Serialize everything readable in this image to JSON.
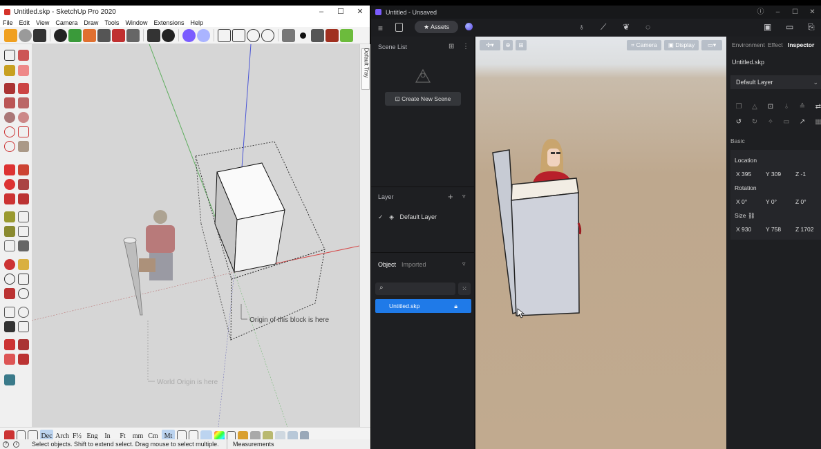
{
  "sketchup": {
    "title": "Untitled.skp - SketchUp Pro 2020",
    "menu": [
      "File",
      "Edit",
      "View",
      "Camera",
      "Draw",
      "Tools",
      "Window",
      "Extensions",
      "Help"
    ],
    "tray_label": "Default Tray",
    "units": [
      "Dec",
      "Arch",
      "F½",
      "Eng",
      "In",
      "Ft",
      "mm",
      "Cm",
      "Mt"
    ],
    "active_unit": "Mt",
    "annotation_block": "Origin of this block is here",
    "annotation_world": "World Origin is here",
    "status_message": "Select objects. Shift to extend select. Drag mouse to select multiple.",
    "measurements_label": "Measurements",
    "colors": {
      "accent": "#d5332a",
      "viewport": "#d6d6d6"
    }
  },
  "d5": {
    "title": "Untitled - Unsaved",
    "assets_button": "Assets",
    "scene_list_title": "Scene List",
    "create_scene_button": "Create New Scene",
    "layer_title": "Layer",
    "layer_item": "Default Layer",
    "object_tab": "Object",
    "imported_tab": "Imported",
    "object_item": "Untitled.skp",
    "viewport_buttons": {
      "camera": "Camera",
      "display": "Display"
    },
    "inspector": {
      "tabs": [
        "Environment",
        "Effect",
        "Inspector"
      ],
      "active_tab": "Inspector",
      "file_name": "Untitled.skp",
      "layer_select": "Default Layer",
      "basic_label": "Basic",
      "location_label": "Location",
      "location": {
        "x": "X 395",
        "y": "Y 309",
        "z": "Z -1"
      },
      "rotation_label": "Rotation",
      "rotation": {
        "x": "X 0°",
        "y": "Y 0°",
        "z": "Z 0°"
      },
      "size_label": "Size",
      "size": {
        "x": "X 930",
        "y": "Y 758",
        "z": "Z 1702"
      }
    },
    "colors": {
      "accent": "#1f7ae8",
      "panel": "#1e1f22"
    }
  }
}
